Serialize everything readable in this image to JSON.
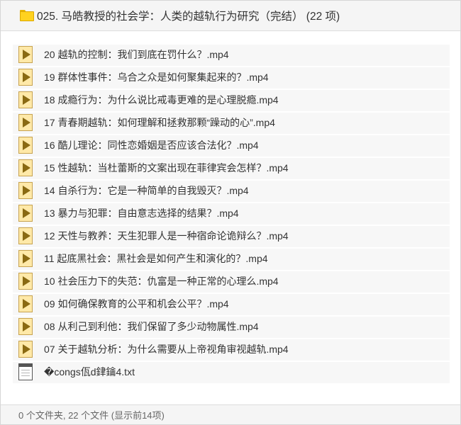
{
  "header": {
    "icon": "folder-icon",
    "title": "025. 马皓教授的社会学：人类的越轨行为研究（完结） (22 项)"
  },
  "files": [
    {
      "name": "20 越轨的控制：我们到底在罚什么？.mp4",
      "icon": "video-file-icon"
    },
    {
      "name": "19 群体性事件：乌合之众是如何聚集起来的？.mp4",
      "icon": "video-file-icon"
    },
    {
      "name": "18 成瘾行为：为什么说比戒毒更难的是心理脱瘾.mp4",
      "icon": "video-file-icon"
    },
    {
      "name": "17 青春期越轨：如何理解和拯救那颗“躁动的心”.mp4",
      "icon": "video-file-icon"
    },
    {
      "name": "16 酷儿理论：同性恋婚姻是否应该合法化？.mp4",
      "icon": "video-file-icon"
    },
    {
      "name": "15 性越轨：当杜蕾斯的文案出现在菲律宾会怎样？.mp4",
      "icon": "video-file-icon"
    },
    {
      "name": "14 自杀行为：它是一种简单的自我毁灭？.mp4",
      "icon": "video-file-icon"
    },
    {
      "name": "13 暴力与犯罪：自由意志选择的结果？.mp4",
      "icon": "video-file-icon"
    },
    {
      "name": "12 天性与教养：天生犯罪人是一种宿命论诡辩么？.mp4",
      "icon": "video-file-icon"
    },
    {
      "name": "11 起底黑社会：黑社会是如何产生和演化的？.mp4",
      "icon": "video-file-icon"
    },
    {
      "name": "10 社会压力下的失范：仇富是一种正常的心理么.mp4",
      "icon": "video-file-icon"
    },
    {
      "name": "09 如何确保教育的公平和机会公平？.mp4",
      "icon": "video-file-icon"
    },
    {
      "name": "08 从利己到利他：我们保留了多少动物属性.mp4",
      "icon": "video-file-icon"
    },
    {
      "name": "07 关于越轨分析：为什么需要从上帝视角审视越轨.mp4",
      "icon": "video-file-icon"
    },
    {
      "name": "�congs佤d銉鑰4.txt",
      "icon": "text-file-icon"
    }
  ],
  "footer": {
    "status": "0 个文件夹, 22 个文件 (显示前14项)"
  }
}
